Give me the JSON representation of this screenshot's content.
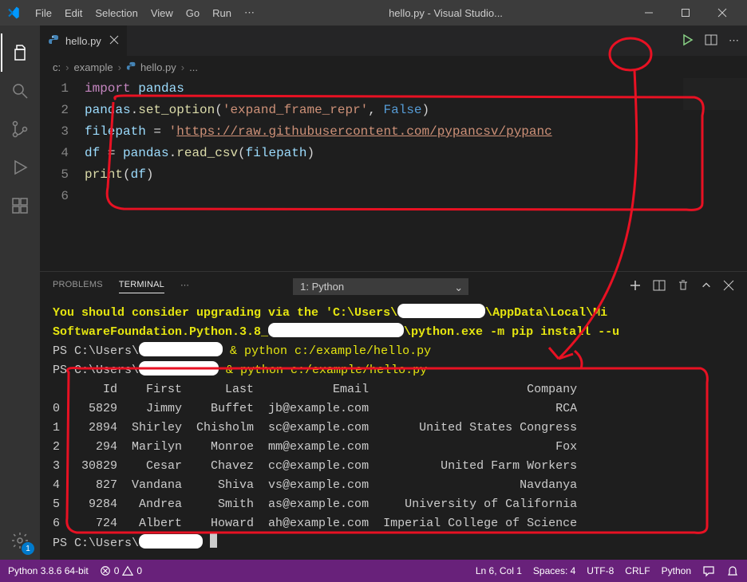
{
  "window": {
    "title": "hello.py - Visual Studio..."
  },
  "menu": {
    "file": "File",
    "edit": "Edit",
    "selection": "Selection",
    "view": "View",
    "go": "Go",
    "run": "Run",
    "ellipsis": "⋯"
  },
  "activity": {
    "settings_badge": "1"
  },
  "tabs": {
    "active": {
      "label": "hello.py"
    }
  },
  "breadcrumbs": {
    "parts": [
      "c:",
      "example",
      "hello.py",
      "..."
    ],
    "part0": "c:",
    "part1": "example",
    "part2": "hello.py",
    "part3": "..."
  },
  "editor": {
    "lines": [
      {
        "n": "1",
        "segments": [
          {
            "t": "import",
            "c": "kw"
          },
          {
            "t": " ",
            "c": "plain"
          },
          {
            "t": "pandas",
            "c": "ident"
          }
        ]
      },
      {
        "n": "2",
        "segments": [
          {
            "t": "pandas",
            "c": "ident"
          },
          {
            "t": ".",
            "c": "plain"
          },
          {
            "t": "set_option",
            "c": "fn"
          },
          {
            "t": "(",
            "c": "plain"
          },
          {
            "t": "'expand_frame_repr'",
            "c": "str"
          },
          {
            "t": ", ",
            "c": "plain"
          },
          {
            "t": "False",
            "c": "const"
          },
          {
            "t": ")",
            "c": "plain"
          }
        ]
      },
      {
        "n": "3",
        "segments": [
          {
            "t": "filepath ",
            "c": "ident"
          },
          {
            "t": "= ",
            "c": "plain"
          },
          {
            "t": "'",
            "c": "str"
          },
          {
            "t": "https://raw.githubusercontent.com/pypancsv/pypanc",
            "c": "str-link"
          }
        ]
      },
      {
        "n": "4",
        "segments": [
          {
            "t": "df ",
            "c": "ident"
          },
          {
            "t": "= ",
            "c": "plain"
          },
          {
            "t": "pandas",
            "c": "ident"
          },
          {
            "t": ".",
            "c": "plain"
          },
          {
            "t": "read_csv",
            "c": "fn"
          },
          {
            "t": "(",
            "c": "plain"
          },
          {
            "t": "filepath",
            "c": "ident"
          },
          {
            "t": ")",
            "c": "plain"
          }
        ]
      },
      {
        "n": "5",
        "segments": [
          {
            "t": "print",
            "c": "fn"
          },
          {
            "t": "(",
            "c": "plain"
          },
          {
            "t": "df",
            "c": "ident"
          },
          {
            "t": ")",
            "c": "plain"
          }
        ]
      },
      {
        "n": "6",
        "segments": []
      }
    ]
  },
  "panel": {
    "tabs": {
      "problems": "PROBLEMS",
      "terminal": "TERMINAL",
      "more": "⋯"
    },
    "selector": "1: Python"
  },
  "terminal": {
    "l1a": "You should consider upgrading via the 'C:\\Users\\",
    "l1b": "\\AppData\\Local\\Mi",
    "l2a": "SoftwareFoundation.Python.3.8_",
    "l2b": "\\python.exe -m pip install --u",
    "l3a": "PS C:\\Users\\",
    "l3b": " & python c:/example/hello.py",
    "l4a": "PS C:\\Users\\",
    "l4b": " & python c:/example/hello.py",
    "header": "       Id    First      Last           Email                      Company",
    "r0": "0    5829    Jimmy    Buffet  jb@example.com                          RCA",
    "r1": "1    2894  Shirley  Chisholm  sc@example.com       United States Congress",
    "r2": "2     294  Marilyn    Monroe  mm@example.com                          Fox",
    "r3": "3   30829    Cesar    Chavez  cc@example.com          United Farm Workers",
    "r4": "4     827  Vandana     Shiva  vs@example.com                     Navdanya",
    "r5": "5    9284   Andrea     Smith  as@example.com     University of California",
    "r6": "6     724   Albert    Howard  ah@example.com  Imperial College of Science",
    "prompt_final": "PS C:\\Users\\"
  },
  "statusbar": {
    "python": "Python 3.8.6 64-bit",
    "errors": "0",
    "warnings": "0",
    "ln_col": "Ln 6, Col 1",
    "spaces": "Spaces: 4",
    "encoding": "UTF-8",
    "eol": "CRLF",
    "language": "Python"
  },
  "chart_data": {
    "type": "table",
    "columns": [
      "Id",
      "First",
      "Last",
      "Email",
      "Company"
    ],
    "rows": [
      [
        5829,
        "Jimmy",
        "Buffet",
        "jb@example.com",
        "RCA"
      ],
      [
        2894,
        "Shirley",
        "Chisholm",
        "sc@example.com",
        "United States Congress"
      ],
      [
        294,
        "Marilyn",
        "Monroe",
        "mm@example.com",
        "Fox"
      ],
      [
        30829,
        "Cesar",
        "Chavez",
        "cc@example.com",
        "United Farm Workers"
      ],
      [
        827,
        "Vandana",
        "Shiva",
        "vs@example.com",
        "Navdanya"
      ],
      [
        9284,
        "Andrea",
        "Smith",
        "as@example.com",
        "University of California"
      ],
      [
        724,
        "Albert",
        "Howard",
        "ah@example.com",
        "Imperial College of Science"
      ]
    ]
  }
}
